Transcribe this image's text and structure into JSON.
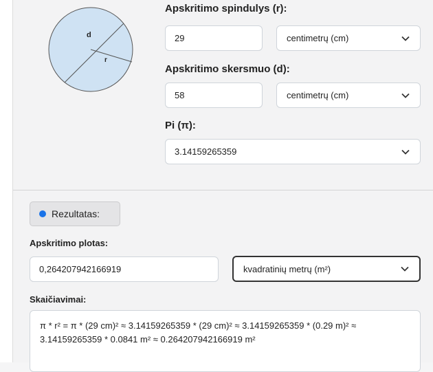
{
  "radius_field": {
    "label": "Apskritimo spindulys (r):",
    "value": "29",
    "unit": "centimetrų (cm)"
  },
  "diameter_field": {
    "label": "Apskritimo skersmuo (d):",
    "value": "58",
    "unit": "centimetrų (cm)"
  },
  "pi_field": {
    "label": "Pi (π):",
    "value": "3.14159265359"
  },
  "diagram": {
    "diameter_letter": "d",
    "radius_letter": "r",
    "fill_color": "#cfe2f3"
  },
  "result": {
    "button_label": "Rezultatas:",
    "dot_color": "#1a73e8"
  },
  "area": {
    "label": "Apskritimo plotas:",
    "value": "0,264207942166919",
    "unit": "kvadratinių metrų (m²)"
  },
  "calculations": {
    "label": "Skaičiavimai:",
    "text": "π * r² = π * (29 cm)² ≈ 3.14159265359 * (29 cm)² ≈ 3.14159265359 * (0.29 m)² ≈ 3.14159265359 * 0.0841 m² ≈ 0.264207942166919 m²"
  }
}
